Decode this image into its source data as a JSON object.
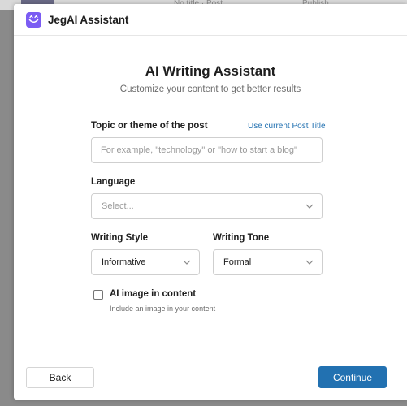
{
  "background": {
    "post_title": "No title · Post",
    "top_right": "Publish"
  },
  "header": {
    "logo_icon": "robot-face-icon",
    "title": "JegAI Assistant"
  },
  "main": {
    "title": "AI Writing Assistant",
    "subtitle": "Customize your content to get better results",
    "topic": {
      "label": "Topic or theme of the post",
      "link": "Use current Post Title",
      "placeholder": "For example, \"technology\" or \"how to start a blog\"",
      "value": ""
    },
    "language": {
      "label": "Language",
      "placeholder": "Select..."
    },
    "writing_style": {
      "label": "Writing Style",
      "value": "Informative"
    },
    "writing_tone": {
      "label": "Writing Tone",
      "value": "Formal"
    },
    "ai_image": {
      "label": "AI image in content",
      "help": "Include an image in your content",
      "checked": false
    }
  },
  "footer": {
    "back_label": "Back",
    "continue_label": "Continue"
  },
  "colors": {
    "accent": "#2271b1",
    "logo": "#7b5cf3"
  }
}
